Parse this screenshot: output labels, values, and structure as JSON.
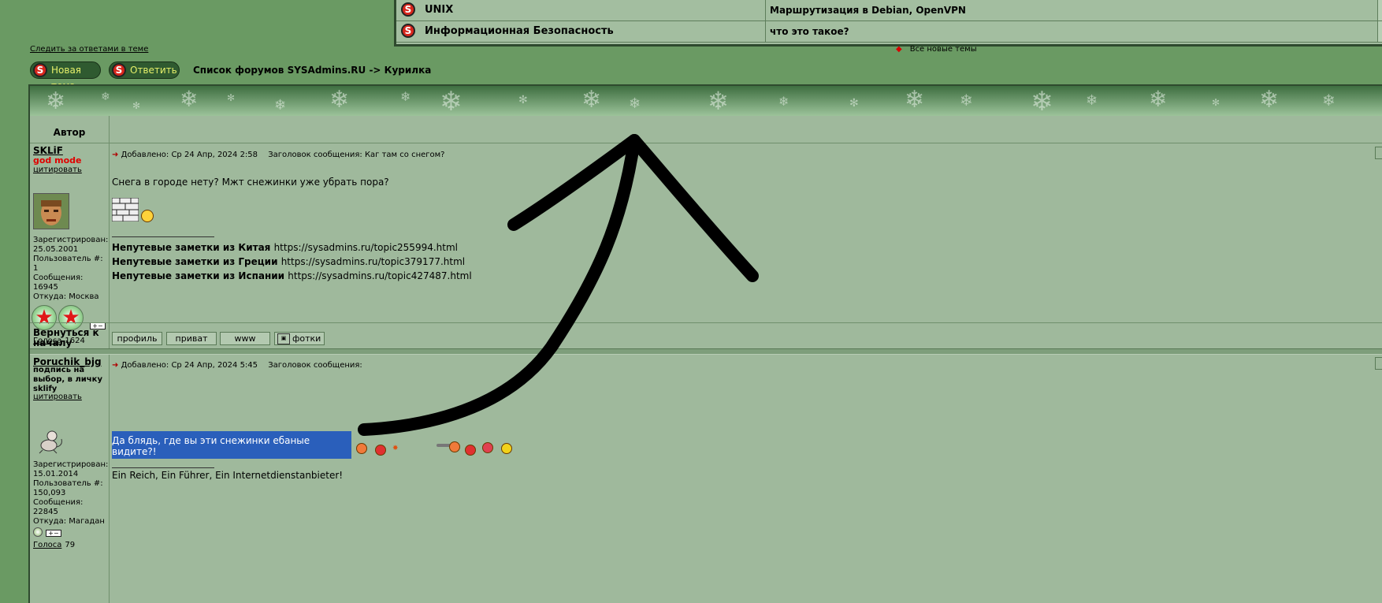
{
  "top_forums": [
    {
      "name": "UNIX",
      "last_topic": "Маршрутизация в Debian, OpenVPN"
    },
    {
      "name": "Информационная Безопасность",
      "last_topic": "что это такое?"
    }
  ],
  "links": {
    "follow": "Следить за ответами в теме",
    "new_topics": "Все новые темы"
  },
  "buttons": {
    "new_topic": "Новая тема",
    "reply": "Ответить"
  },
  "breadcrumb": "Список форумов SYSAdmins.RU -> Курилка",
  "table": {
    "author_header": "Автор"
  },
  "posts": [
    {
      "username": "SKLiF",
      "rank": "god mode",
      "quote": "цитировать",
      "registered": "Зарегистрирован: 25.05.2001",
      "user_no": "Пользователь #: 1",
      "messages": "Сообщения: 16945",
      "from": "Откуда: Москва",
      "votes_label": "Голоса",
      "votes_count": "1624",
      "posted": "Добавлено: Ср 24 Апр, 2024 2:58",
      "subject": "Заголовок сообщения: Каг там со снегом?",
      "text": "Снега в городе нету? Мжт снежинки уже убрать пора?",
      "signature": [
        {
          "label": "Непутевые заметки из Китая",
          "url": "https://sysadmins.ru/topic255994.html"
        },
        {
          "label": "Непутевые заметки из Греции",
          "url": "https://sysadmins.ru/topic379177.html"
        },
        {
          "label": "Непутевые заметки из Испании",
          "url": "https://sysadmins.ru/topic427487.html"
        }
      ],
      "back_to_top": "Вернуться к началу",
      "actions": [
        "профиль",
        "приват",
        "www",
        "фотки"
      ]
    },
    {
      "username": "Poruchik_bjg",
      "rank": "подпись на выбор, в личку sklify",
      "quote": "цитировать",
      "registered": "Зарегистрирован: 15.01.2014",
      "user_no": "Пользователь #: 150,093",
      "messages": "Сообщения: 22845",
      "from": "Откуда: Магадан",
      "votes_label": "Голоса",
      "votes_count": "79",
      "posted": "Добавлено: Ср 24 Апр, 2024 5:45",
      "subject": "Заголовок сообщения:",
      "text": "Да блядь, где вы эти снежинки ебаные видите?!",
      "signature_text": "Ein Reich, Ein Führer, Ein Internetdienstanbieter!"
    }
  ],
  "icons": {
    "forum": "s-logo-icon",
    "post": "post-arrow-icon",
    "snowflake": "snowflake-icon",
    "photo": "camera-icon"
  },
  "colors": {
    "page_bg": "#6a9a63",
    "panel_bg": "#9fb99c",
    "header_btn": "#2f5a30",
    "selection": "#2a5fbb",
    "rank_red": "#e00000"
  }
}
